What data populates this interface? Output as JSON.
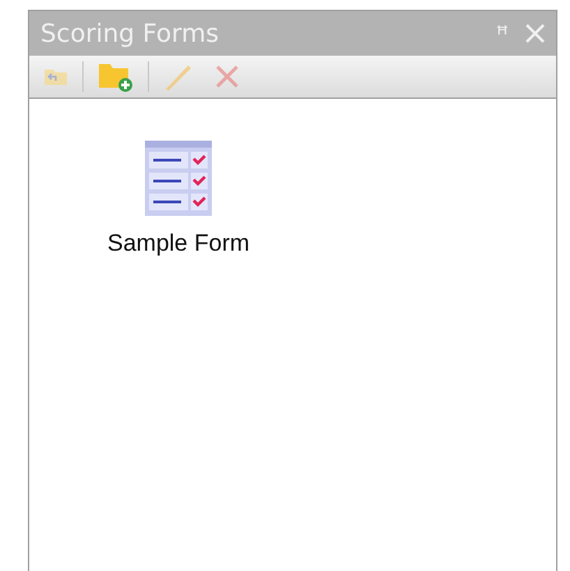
{
  "panel": {
    "title": "Scoring Forms",
    "pin_glyph": "ꟸ"
  },
  "toolbar": [
    {
      "kind": "up-folder",
      "disabled": true
    },
    {
      "kind": "new-folder",
      "disabled": false
    },
    {
      "kind": "edit",
      "disabled": true
    },
    {
      "kind": "delete",
      "disabled": true
    }
  ],
  "items": [
    {
      "label": "Sample Form",
      "selected": false
    }
  ]
}
